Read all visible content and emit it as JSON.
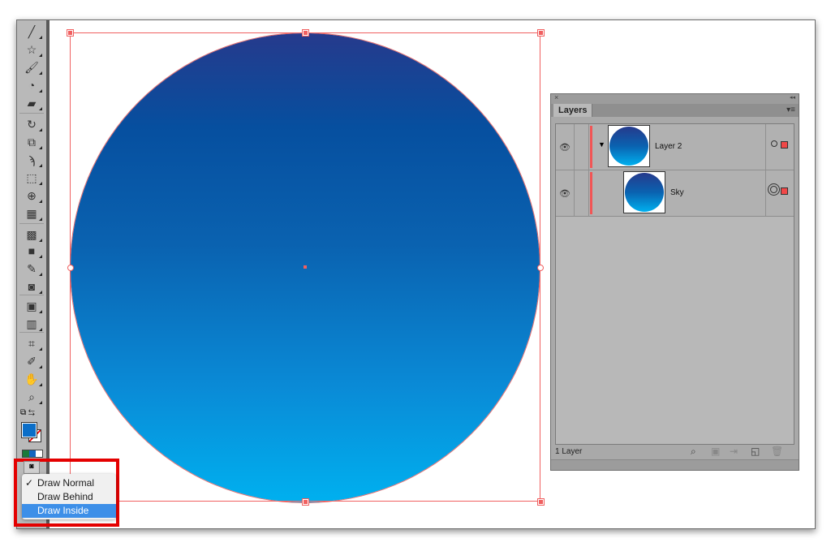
{
  "toolbar": {
    "tools": [
      {
        "icon": "line-segment-icon",
        "glyph": "╱"
      },
      {
        "icon": "star-icon",
        "glyph": "☆"
      },
      {
        "icon": "paintbrush-icon",
        "glyph": "🖌"
      },
      {
        "icon": "blob-brush-icon",
        "glyph": "◔"
      },
      {
        "icon": "eraser-icon",
        "glyph": "▰"
      },
      {
        "icon": "rotate-icon",
        "glyph": "↻"
      },
      {
        "icon": "scale-icon",
        "glyph": "⧉"
      },
      {
        "icon": "warp-icon",
        "glyph": "ϡ"
      },
      {
        "icon": "free-transform-icon",
        "glyph": "⬚"
      },
      {
        "icon": "shape-builder-icon",
        "glyph": "⊕"
      },
      {
        "icon": "perspective-grid-icon",
        "glyph": "▦"
      },
      {
        "icon": "mesh-icon",
        "glyph": "▩"
      },
      {
        "icon": "gradient-icon",
        "glyph": "■"
      },
      {
        "icon": "eyedropper-icon",
        "glyph": "✎"
      },
      {
        "icon": "blend-icon",
        "glyph": "◙"
      },
      {
        "icon": "symbol-sprayer-icon",
        "glyph": "▣"
      },
      {
        "icon": "column-graph-icon",
        "glyph": "▥"
      },
      {
        "icon": "artboard-icon",
        "glyph": "⌗"
      },
      {
        "icon": "slice-icon",
        "glyph": "✐"
      },
      {
        "icon": "hand-icon",
        "glyph": "✋"
      },
      {
        "icon": "zoom-icon",
        "glyph": "⌕"
      }
    ],
    "fill_color": "#0a6ec8",
    "stroke": "none"
  },
  "canvas": {
    "gradient_top": "#263a8c",
    "gradient_bottom": "#00b0ef",
    "selection_color": "#f06060"
  },
  "layers_panel": {
    "close_label": "×",
    "collapse_label": "◂◂",
    "tab_label": "Layers",
    "menu_label": "▾≡",
    "rows": [
      {
        "name": "Layer 2",
        "expanded": true
      },
      {
        "name": "Sky"
      }
    ],
    "footer_status": "1 Layer"
  },
  "draw_mode_menu": {
    "items": [
      {
        "label": "Draw Normal",
        "checked": true
      },
      {
        "label": "Draw Behind",
        "checked": false
      },
      {
        "label": "Draw Inside",
        "checked": false,
        "highlighted": true
      }
    ],
    "checkmark": "✓"
  }
}
